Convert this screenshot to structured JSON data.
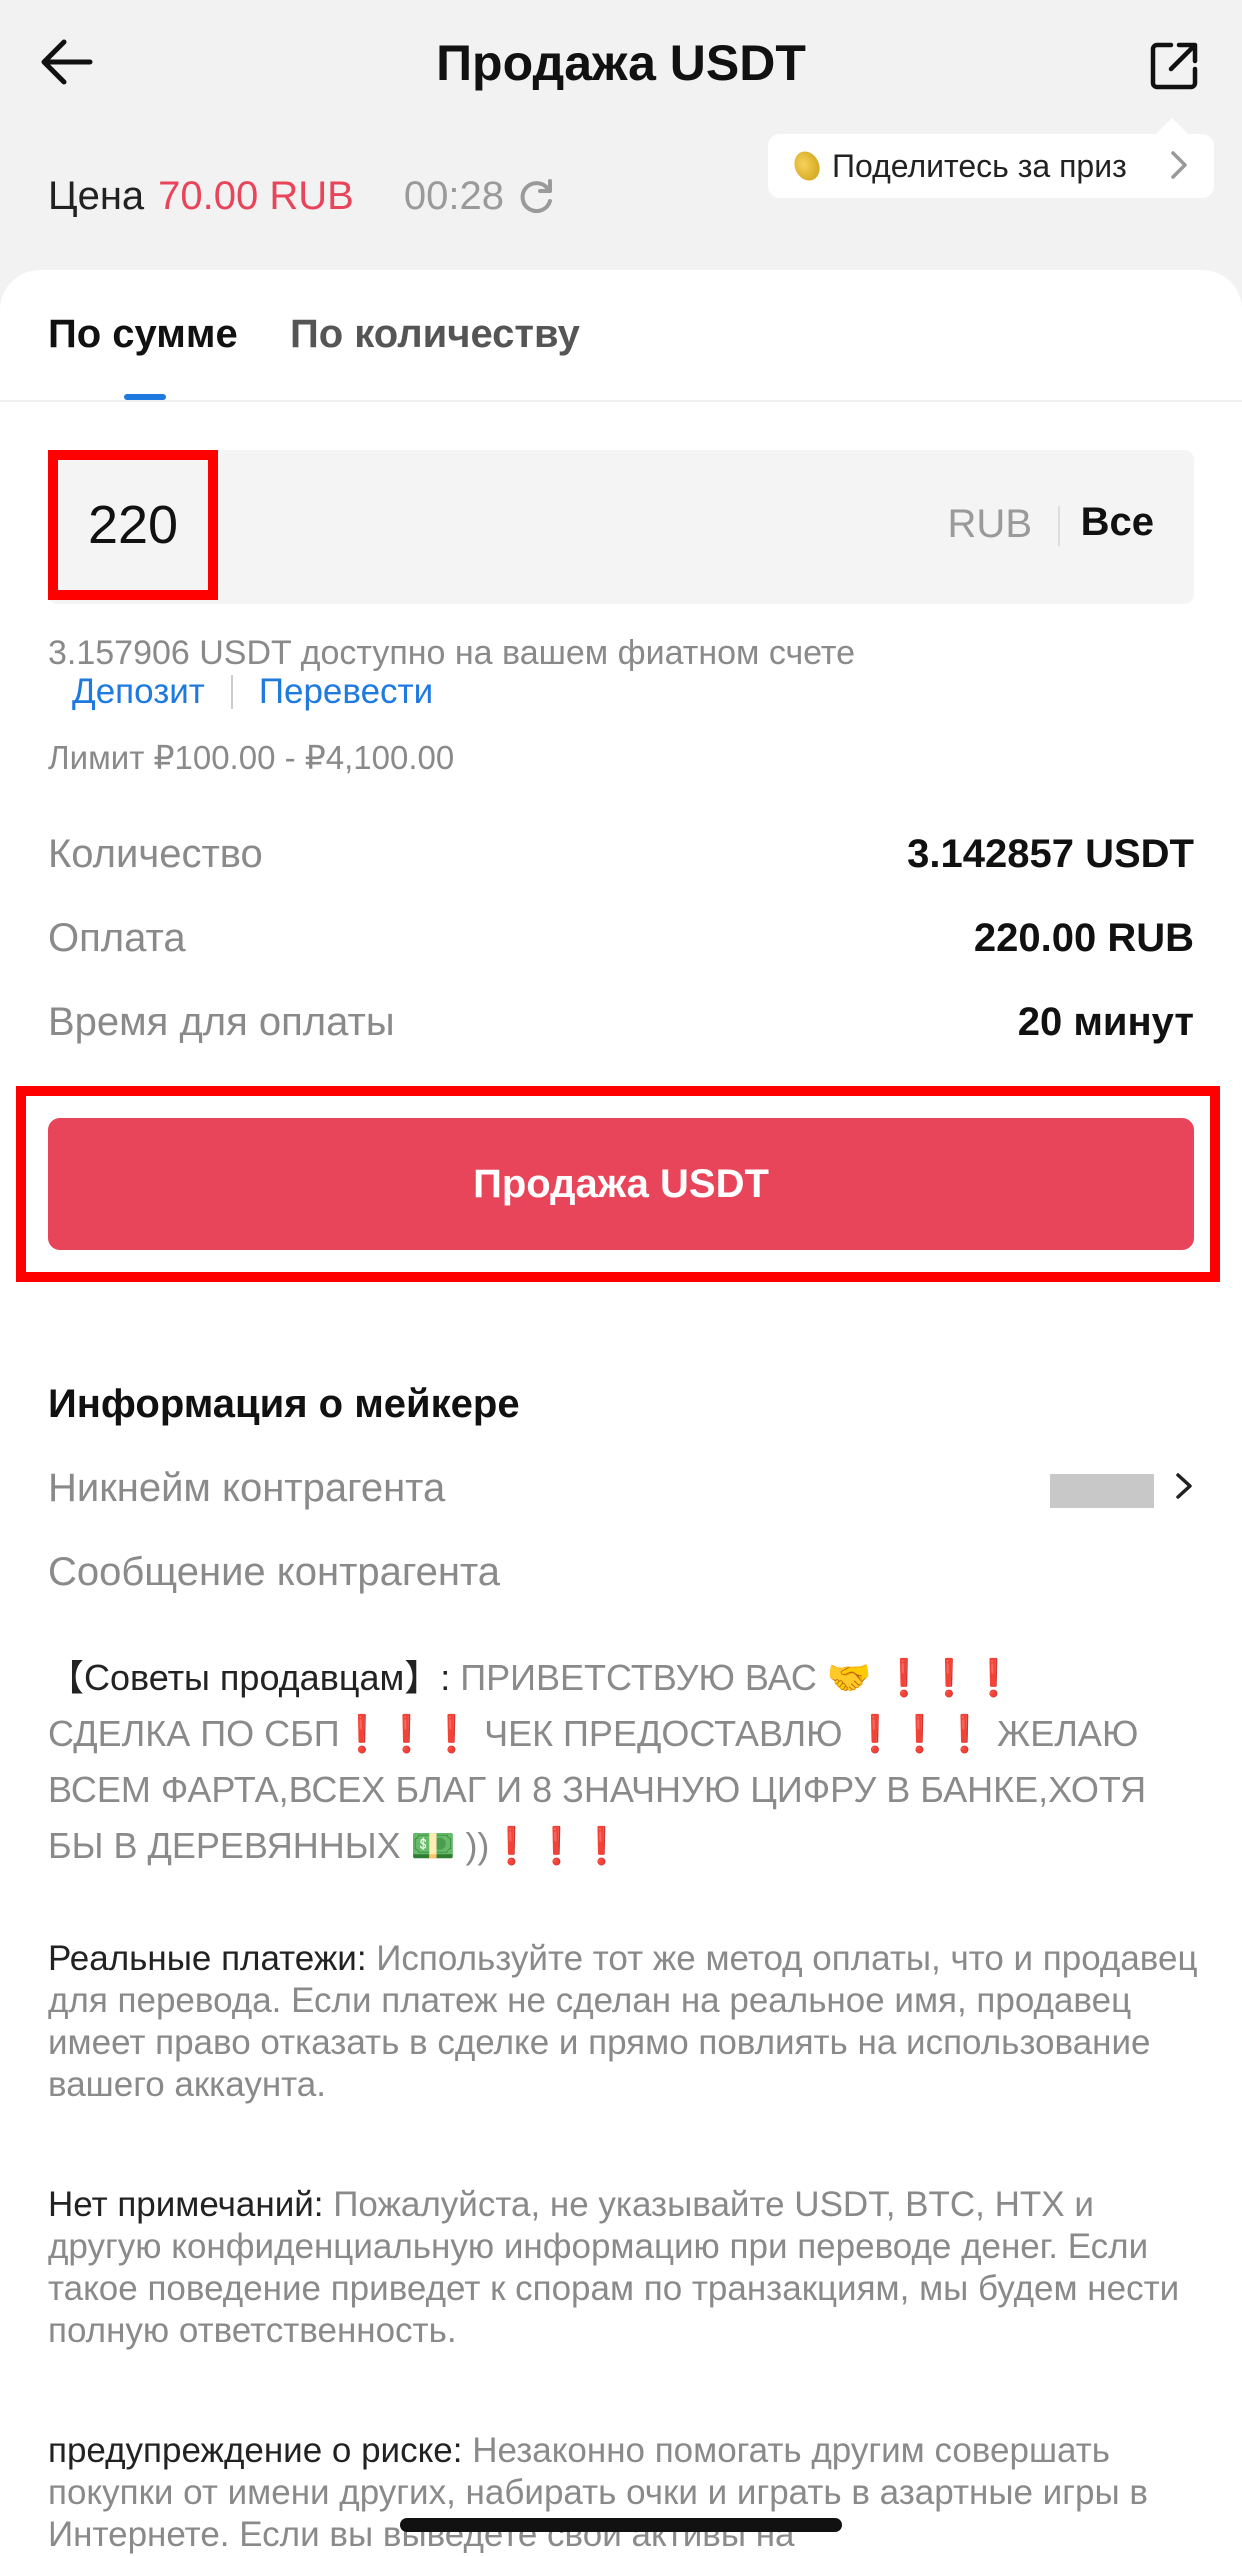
{
  "header": {
    "title": "Продажа USDT",
    "prize_label": "Поделитесь за приз"
  },
  "price": {
    "label": "Цена",
    "value": "70.00 RUB",
    "timer": "00:28"
  },
  "tabs": [
    {
      "label": "По сумме",
      "active": true
    },
    {
      "label": "По количеству",
      "active": false
    }
  ],
  "amount": {
    "value": "220",
    "currency": "RUB",
    "all_label": "Все"
  },
  "balance": {
    "available_text": "3.157906 USDT доступно на вашем фиатном счете",
    "deposit_link": "Депозит",
    "transfer_link": "Перевести",
    "limit_text": "Лимит ₽100.00 - ₽4,100.00"
  },
  "summary": [
    {
      "label": "Количество",
      "value": "3.142857 USDT"
    },
    {
      "label": "Оплата",
      "value": "220.00 RUB"
    },
    {
      "label": "Время для оплаты",
      "value": "20 минут"
    }
  ],
  "sell_button": "Продажа USDT",
  "maker": {
    "section_title": "Информация о мейкере",
    "nickname_label": "Никнейм контрагента",
    "message_label": "Сообщение контрагента",
    "message_lead": "【Советы продавцам】: ",
    "message_part1": "ПРИВЕТСТВУЮ ВАС 🤝 ",
    "message_part2": "СДЕЛКА ПО СБП",
    "message_part3": " ЧЕК ПРЕДОСТАВЛЮ ",
    "message_part4": " ЖЕЛАЮ ВСЕМ ФАРТА,ВСЕХ БЛАГ И 8 ЗНАЧНУЮ ЦИФРУ В БАНКЕ,ХОТЯ БЫ В ДЕРЕВЯННЫХ 💵 ))",
    "exclaim": "❗❗❗"
  },
  "notices": [
    {
      "label": "Реальные платежи:",
      "text": "  Используйте тот же метод оплаты, что и продавец для перевода. Если платеж не сделан на реальное имя, продавец имеет право отказать в сделке и прямо повлиять на использование вашего аккаунта."
    },
    {
      "label": "Нет примечаний:",
      "text": " Пожалуйста, не указывайте USDT, BTC, HTX и другую конфиденциальную информацию при переводе денег. Если такое поведение приведет к спорам по транзакциям, мы будем нести полную ответственность."
    },
    {
      "label": "предупреждение о риске:",
      "text": " Незаконно помогать другим совершать покупки от имени других, набирать очки и играть в азартные игры в Интернете. Если вы выведете свои активы на"
    }
  ],
  "colors": {
    "accent_red": "#e8445a",
    "link_blue": "#1f7ae0",
    "highlight_box": "#ff0000"
  }
}
